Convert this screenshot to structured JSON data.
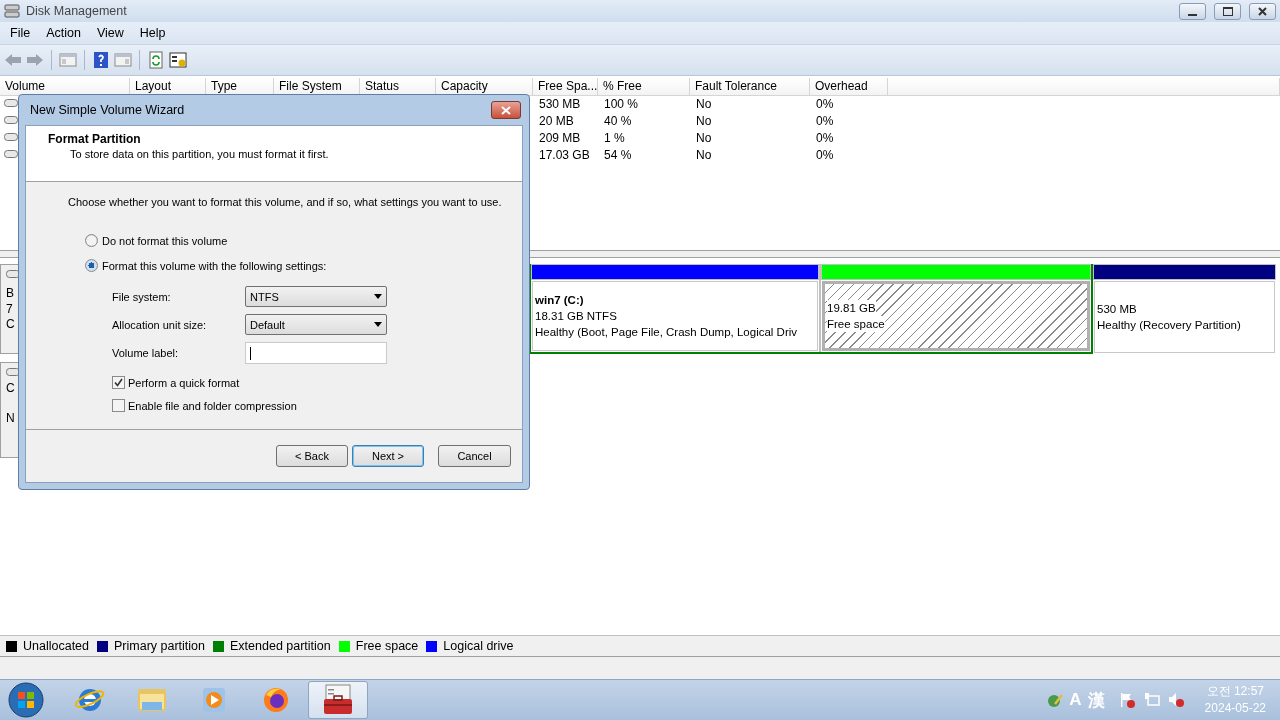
{
  "window": {
    "title": "Disk Management"
  },
  "menu": [
    "File",
    "Action",
    "View",
    "Help"
  ],
  "table": {
    "columns": [
      "Volume",
      "Layout",
      "Type",
      "File System",
      "Status",
      "Capacity",
      "Free Spa...",
      "% Free",
      "Fault Tolerance",
      "Overhead"
    ],
    "rows": [
      {
        "free_space": "530 MB",
        "percent_free": "100 %",
        "fault_tolerance": "No",
        "overhead": "0%"
      },
      {
        "free_space": "20 MB",
        "percent_free": "40 %",
        "fault_tolerance": "No",
        "overhead": "0%"
      },
      {
        "free_space": "209 MB",
        "percent_free": "1 %",
        "fault_tolerance": "No",
        "overhead": "0%"
      },
      {
        "free_space": "17.03 GB",
        "percent_free": "54 %",
        "fault_tolerance": "No",
        "overhead": "0%"
      }
    ]
  },
  "disks": [
    {
      "label_lines": [
        "B",
        "7",
        "C"
      ],
      "partitions": [
        {
          "kind": "logical",
          "name": "win7  (C:)",
          "size": "18.31 GB NTFS",
          "status": "Healthy (Boot, Page File, Crash Dump, Logical Driv",
          "selected": false
        },
        {
          "kind": "free",
          "size": "19.81 GB",
          "status": "Free space",
          "selected": true
        },
        {
          "kind": "primary",
          "size": "530 MB",
          "status": "Healthy (Recovery Partition)",
          "selected": false
        }
      ]
    },
    {
      "label_lines": [
        "C",
        "N"
      ]
    }
  ],
  "legend": [
    {
      "label": "Unallocated",
      "color": "#000000"
    },
    {
      "label": "Primary partition",
      "color": "#000080"
    },
    {
      "label": "Extended partition",
      "color": "#008000"
    },
    {
      "label": "Free space",
      "color": "#00ff00"
    },
    {
      "label": "Logical drive",
      "color": "#0000ff"
    }
  ],
  "dialog": {
    "title": "New Simple Volume Wizard",
    "heading": "Format Partition",
    "subheading": "To store data on this partition, you must format it first.",
    "instruction": "Choose whether you want to format this volume, and if so, what settings you want to use.",
    "options": [
      {
        "label": "Do not format this volume",
        "selected": false
      },
      {
        "label": "Format this volume with the following settings:",
        "selected": true
      }
    ],
    "file_system": {
      "label": "File system:",
      "value": "NTFS"
    },
    "allocation_unit_size": {
      "label": "Allocation unit size:",
      "value": "Default"
    },
    "volume_label": {
      "label": "Volume label:"
    },
    "checkboxes": [
      {
        "label": "Perform a quick format",
        "checked": true
      },
      {
        "label": "Enable file and folder compression",
        "checked": false
      }
    ],
    "buttons": [
      {
        "label": "< Back",
        "default": false
      },
      {
        "label": "Next >",
        "default": true
      },
      {
        "label": "Cancel",
        "default": false
      }
    ]
  },
  "taskbar": {
    "apps": [
      {
        "kind": "browser",
        "selected": false
      },
      {
        "kind": "folders",
        "selected": false
      },
      {
        "kind": "media",
        "selected": false
      },
      {
        "kind": "firefox",
        "selected": false
      },
      {
        "kind": "toolbox",
        "selected": true
      }
    ],
    "input_indicators": [
      "A",
      "漢"
    ],
    "time": "오전 12:57",
    "date": "2024-05-22"
  }
}
